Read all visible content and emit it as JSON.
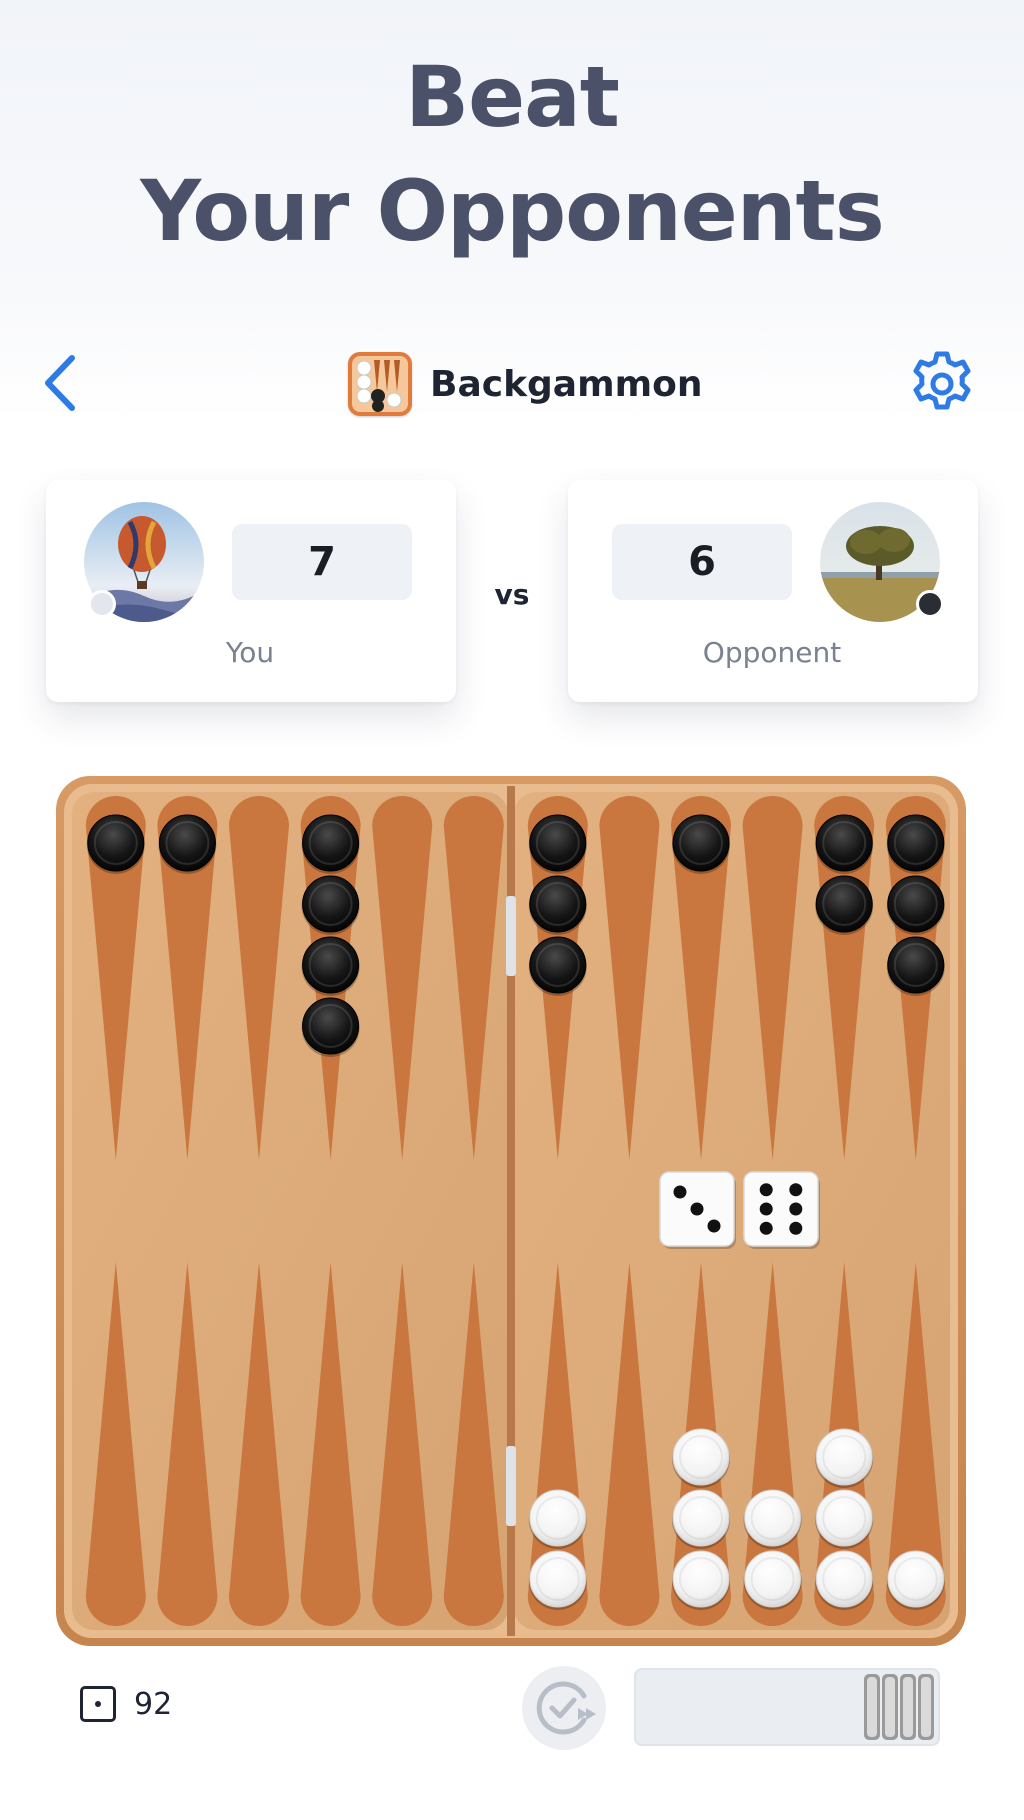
{
  "headline": {
    "line1": "Beat",
    "line2": "Your Opponents"
  },
  "topbar": {
    "title": "Backgammon",
    "back_icon": "chevron-left-icon",
    "settings_icon": "gear-icon",
    "accent": "#2f7be5"
  },
  "players": {
    "you": {
      "score": "7",
      "label": "You",
      "piece_color": "white"
    },
    "opponent": {
      "score": "6",
      "label": "Opponent",
      "piece_color": "black"
    },
    "vs": "vs"
  },
  "board": {
    "top_points": [
      1,
      1,
      0,
      4,
      0,
      0,
      3,
      0,
      1,
      0,
      2,
      3
    ],
    "bottom_points": [
      0,
      0,
      0,
      0,
      0,
      0,
      2,
      0,
      3,
      2,
      3,
      1
    ],
    "top_color": "black",
    "bottom_color": "white",
    "dice": [
      3,
      6
    ]
  },
  "bottombar": {
    "pip_count": "92",
    "autoplay_icon": "autoplay-check-icon",
    "bearoff_checkers": 4
  }
}
